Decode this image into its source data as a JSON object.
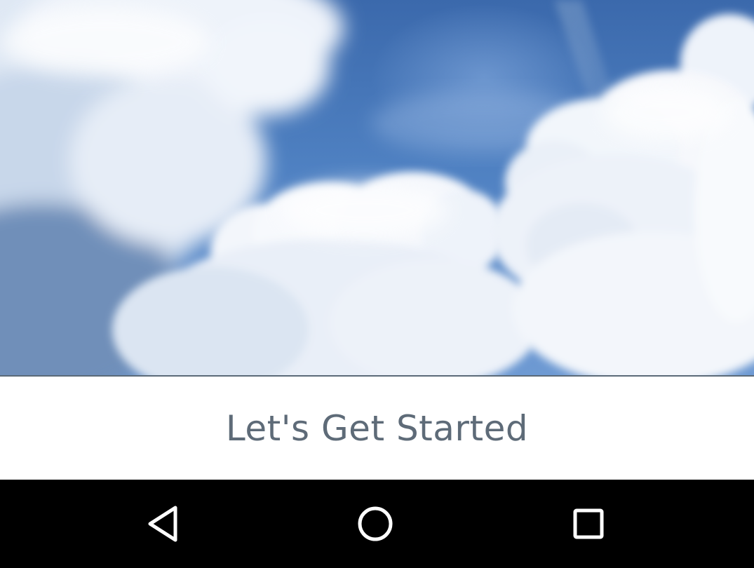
{
  "hero": {
    "image": "sky-with-clouds"
  },
  "caption": {
    "text": "Let's Get Started"
  },
  "navbar": {
    "back_icon": "triangle-back-icon",
    "home_icon": "circle-home-icon",
    "recent_icon": "square-recents-icon"
  },
  "colors": {
    "sky": "#4a7bbf",
    "caption_text": "#5e6b78",
    "navbar": "#000000",
    "nav_icon": "#ffffff"
  }
}
